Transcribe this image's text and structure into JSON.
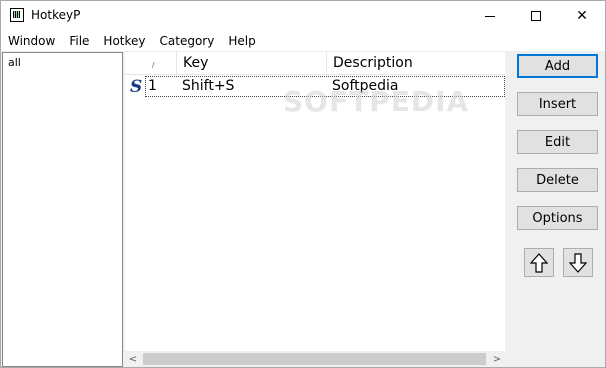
{
  "window": {
    "title": "HotkeyP"
  },
  "menu": {
    "items": [
      "Window",
      "File",
      "Hotkey",
      "Category",
      "Help"
    ]
  },
  "categories": {
    "items": [
      "all"
    ]
  },
  "list": {
    "columns": {
      "num": "",
      "key": "Key",
      "description": "Description"
    },
    "rows": [
      {
        "num": "1",
        "key": "Shift+S",
        "description": "Softpedia"
      }
    ]
  },
  "watermark": "SOFTPEDIA",
  "buttons": {
    "add": "Add",
    "insert": "Insert",
    "edit": "Edit",
    "delete": "Delete",
    "options": "Options"
  },
  "icons": {
    "app": "hotkeyp-app-icon",
    "row": "softpedia-s-icon",
    "up": "arrow-up-icon",
    "down": "arrow-down-icon"
  },
  "colors": {
    "focus_border": "#0078d7",
    "row_icon": "#1a3a8a"
  }
}
